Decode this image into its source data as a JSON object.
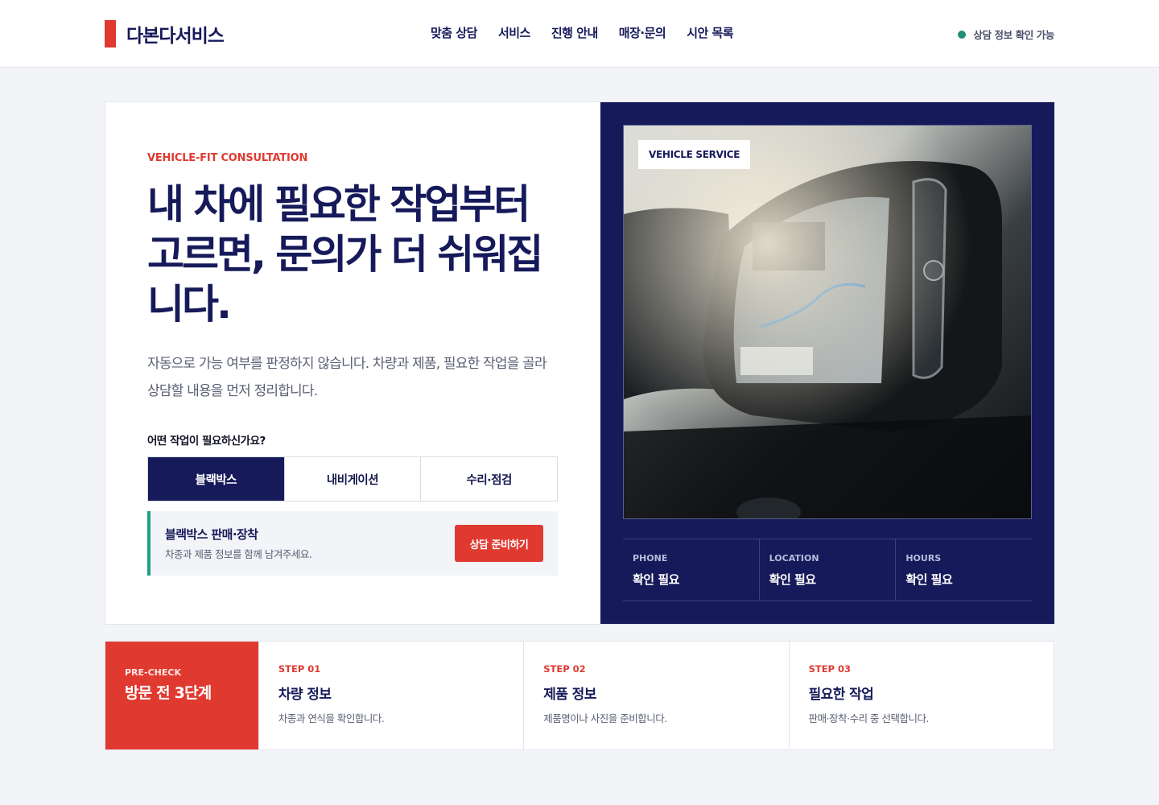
{
  "header": {
    "brand": "다본다서비스",
    "nav": [
      "맞춤 상담",
      "서비스",
      "진행 안내",
      "매장·문의",
      "시안 목록"
    ],
    "status": "상담 정보 확인 가능"
  },
  "hero": {
    "eyebrow": "VEHICLE-FIT CONSULTATION",
    "title": "내 차에 필요한 작업부터 고르면, 문의가 더 쉬워집니다.",
    "description": "자동으로 가능 여부를 판정하지 않습니다. 차량과 제품, 필요한 작업을 골라 상담할 내용을 먼저 정리합니다.",
    "question": "어떤 작업이 필요하신가요?",
    "tabs": [
      "블랙박스",
      "내비게이션",
      "수리·점검"
    ],
    "active_tab": "블랙박스",
    "selection": {
      "title": "블랙박스 판매·장착",
      "subtitle": "차종과 제품 정보를 함께 남겨주세요.",
      "cta": "상담 준비하기"
    }
  },
  "panel": {
    "photo_badge": "VEHICLE SERVICE",
    "info": [
      {
        "label": "PHONE",
        "value": "확인 필요"
      },
      {
        "label": "LOCATION",
        "value": "확인 필요"
      },
      {
        "label": "HOURS",
        "value": "확인 필요"
      }
    ]
  },
  "steps": {
    "eyebrow": "PRE-CHECK",
    "title": "방문 전 3단계",
    "items": [
      {
        "num": "STEP 01",
        "title": "차량 정보",
        "desc": "차종과 연식을 확인합니다."
      },
      {
        "num": "STEP 02",
        "title": "제품 정보",
        "desc": "제품명이나 사진을 준비합니다."
      },
      {
        "num": "STEP 03",
        "title": "필요한 작업",
        "desc": "판매·장착·수리 중 선택합니다."
      }
    ]
  },
  "colors": {
    "navy": "#161a5a",
    "red": "#e03a30",
    "green": "#1f8f77",
    "background": "#f2f4f8"
  }
}
